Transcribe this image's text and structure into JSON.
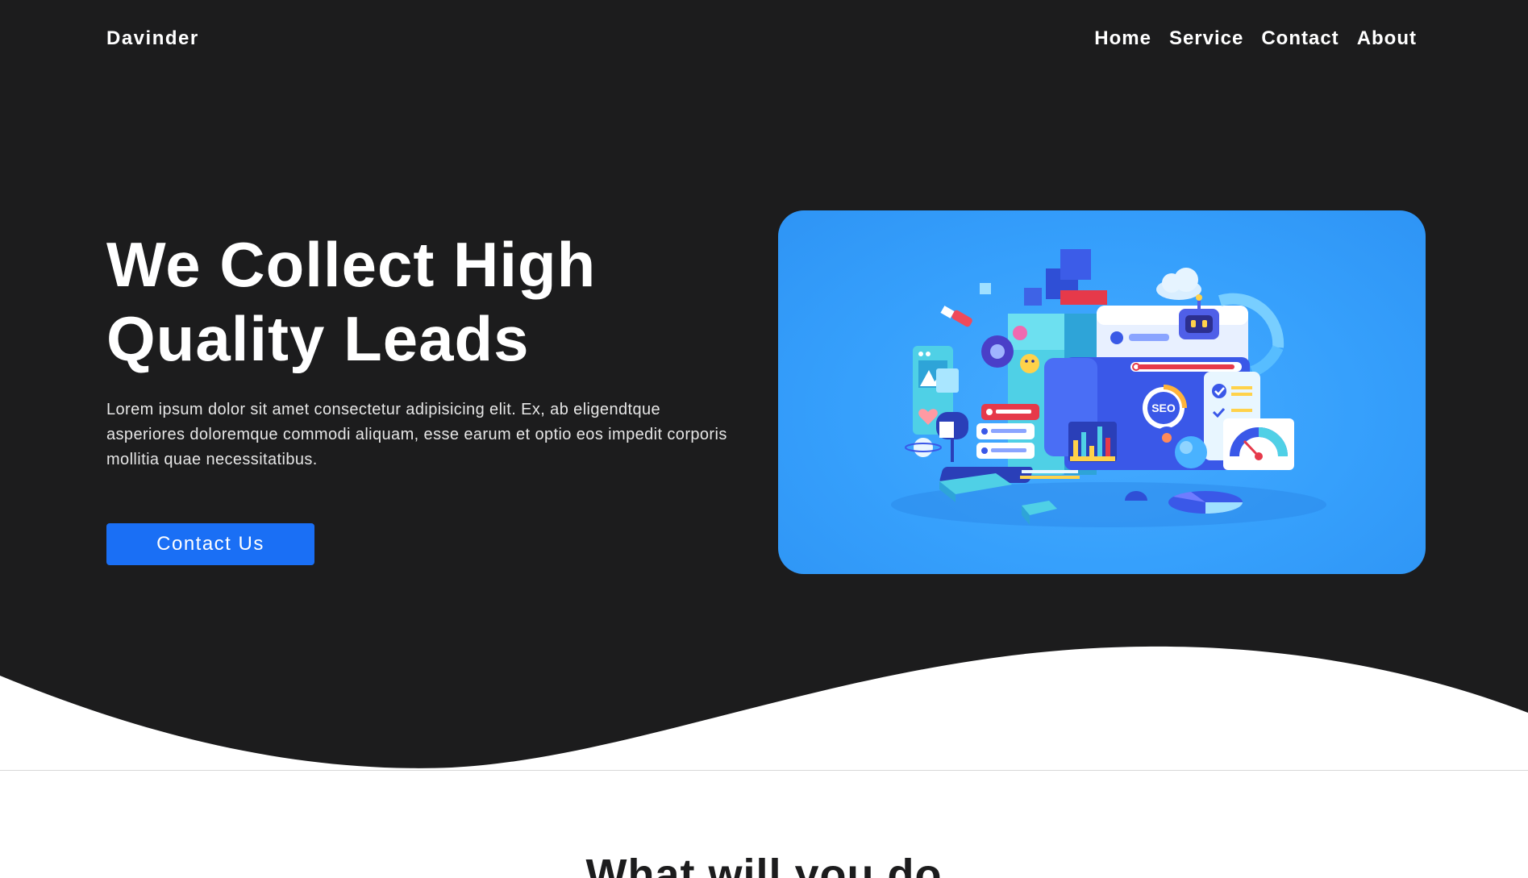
{
  "brand": {
    "name": "Davinder"
  },
  "nav": {
    "links": [
      {
        "label": "Home"
      },
      {
        "label": "Service"
      },
      {
        "label": "Contact"
      },
      {
        "label": "About"
      }
    ]
  },
  "hero": {
    "title_line1": "We Collect High",
    "title_line2": "Quality Leads",
    "description": "Lorem ipsum dolor sit amet consectetur adipisicing elit. Ex, ab eligendtque asperiores doloremque commodi aliquam, esse earum et optio eos impedit corporis mollitia quae necessitatibus.",
    "cta_label": "Contact Us",
    "illustration_badge": "SEO"
  },
  "section": {
    "heading": "What will you do"
  },
  "colors": {
    "hero_background": "#1c1c1d",
    "accent": "#1a6ff5",
    "card_background": "#36a0fc",
    "text_light": "#ffffff"
  },
  "icons": [
    "cloud-icon",
    "robot-icon",
    "gauge-icon",
    "bar-chart-icon",
    "mailbox-icon",
    "keyboard-icon",
    "pie-chart-icon",
    "search-bar-icon"
  ]
}
